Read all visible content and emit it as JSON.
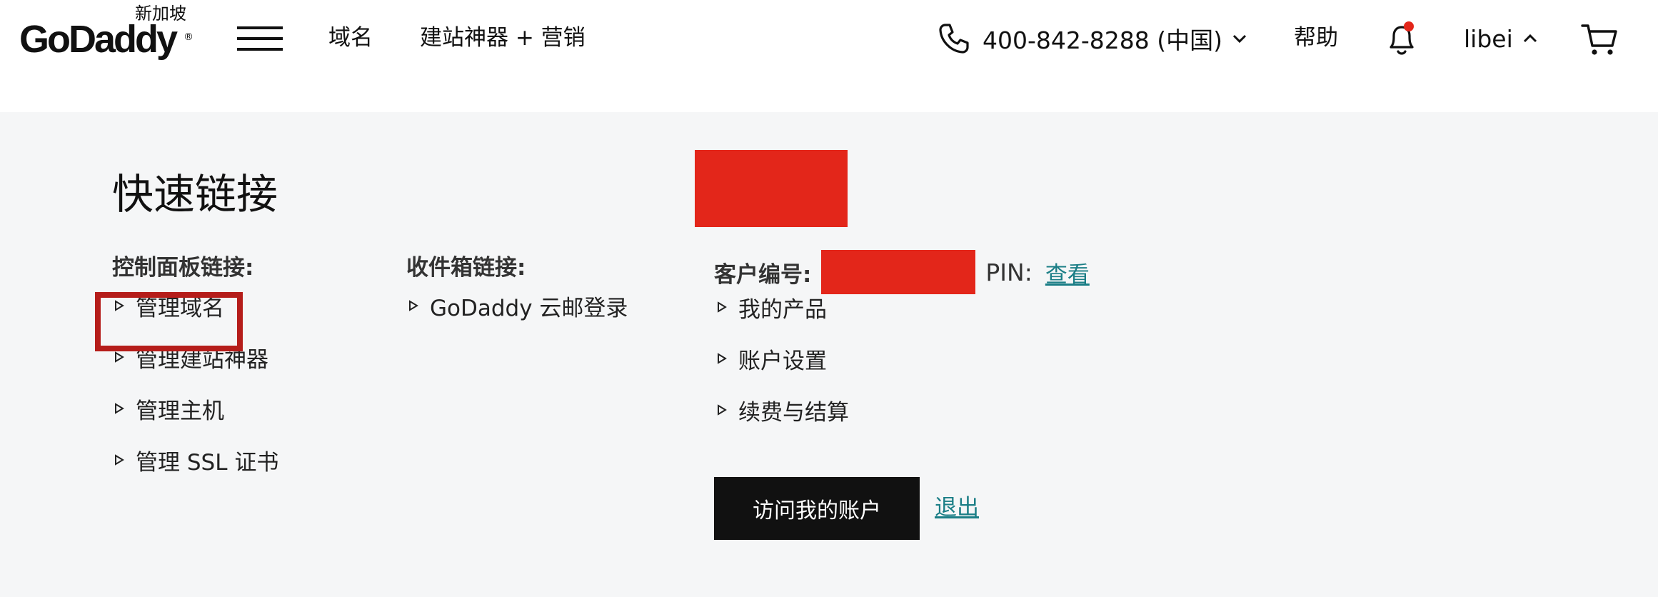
{
  "header": {
    "logo_text": "GoDaddy",
    "logo_region": "新加坡",
    "logo_registered": "®",
    "nav": {
      "domains": "域名",
      "builder": "建站神器 + 营销"
    },
    "phone": "400-842-8288 (中国)",
    "help": "帮助",
    "username": "libei",
    "notification_dot_color": "#e3261a"
  },
  "quick_links": {
    "title": "快速链接",
    "control_panel": {
      "heading": "控制面板链接:",
      "items": [
        {
          "label": "管理域名"
        },
        {
          "label": "管理建站神器"
        },
        {
          "label": "管理主机"
        },
        {
          "label": "管理 SSL 证书"
        }
      ]
    },
    "inbox": {
      "heading": "收件箱链接:",
      "items": [
        {
          "label": "GoDaddy 云邮登录"
        }
      ]
    },
    "account": {
      "customer_label": "客户编号:",
      "pin_label": "PIN:",
      "pin_view": "查看",
      "items": [
        {
          "label": "我的产品"
        },
        {
          "label": "账户设置"
        },
        {
          "label": "续费与结算"
        }
      ],
      "visit_button": "访问我的账户",
      "logout": "退出"
    }
  },
  "colors": {
    "panel_bg": "#f5f6f7",
    "redaction": "#e3261a",
    "highlight_border": "#b51d1a",
    "link_teal": "#1b7e86",
    "button_bg": "#111111"
  }
}
